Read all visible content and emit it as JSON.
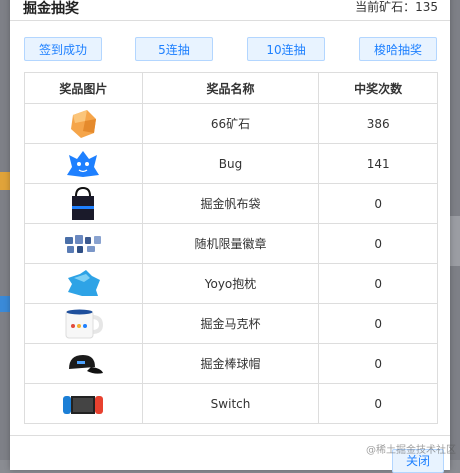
{
  "dialog": {
    "title": "掘金抽奖",
    "ore_text": "当前矿石：135"
  },
  "buttons": [
    {
      "label": "签到成功"
    },
    {
      "label": "5连抽"
    },
    {
      "label": "10连抽"
    },
    {
      "label": "梭哈抽奖"
    }
  ],
  "table": {
    "headers": [
      "奖品图片",
      "奖品名称",
      "中奖次数"
    ],
    "rows": [
      {
        "icon": "orange-ore-icon",
        "name": "66矿石",
        "count": "386"
      },
      {
        "icon": "bug-icon",
        "name": "Bug",
        "count": "141"
      },
      {
        "icon": "tote-bag-icon",
        "name": "掘金帆布袋",
        "count": "0"
      },
      {
        "icon": "badges-icon",
        "name": "随机限量徽章",
        "count": "0"
      },
      {
        "icon": "yoyo-pillow-icon",
        "name": "Yoyo抱枕",
        "count": "0"
      },
      {
        "icon": "mug-icon",
        "name": "掘金马克杯",
        "count": "0"
      },
      {
        "icon": "cap-icon",
        "name": "掘金棒球帽",
        "count": "0"
      },
      {
        "icon": "switch-icon",
        "name": "Switch",
        "count": "0"
      }
    ]
  },
  "footer": {
    "close_label": "关闭"
  },
  "watermark": "@稀土掘金技术社区",
  "colors": {
    "accent": "#1e80ff",
    "button_bg": "#e8f3ff",
    "border": "#dddddd"
  }
}
